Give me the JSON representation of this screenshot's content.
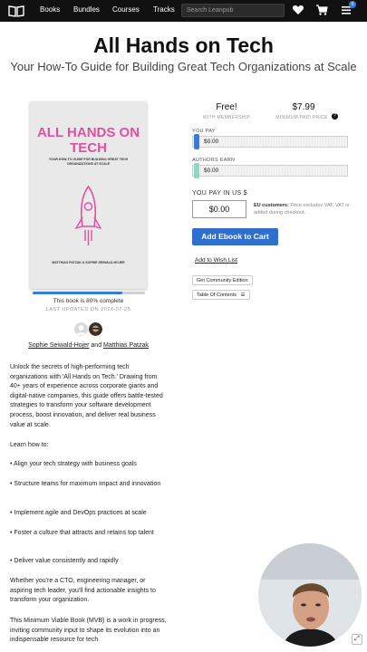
{
  "nav": {
    "links": [
      "Books",
      "Bundles",
      "Courses",
      "Tracks"
    ],
    "search_placeholder": "Search Leanpub",
    "menu_badge": "0",
    "icons": [
      "book-logo-icon",
      "heart-icon",
      "cart-icon",
      "menu-icon"
    ]
  },
  "book": {
    "title": "All Hands on Tech",
    "subtitle": "Your How-To Guide for Building Great Tech Organizations at Scale",
    "cover_title": "ALL HANDS ON TECH",
    "cover_subtitle": "YOUR HOW-TO GUIDE FOR BUILDING GREAT TECH ORGANIZATIONS AT SCALE",
    "cover_authors": "MATTHIAS PATZAK & SOPHIE SEIWALD-HOJER",
    "progress_percent": 80,
    "complete_text": "This book is 80% complete",
    "last_updated": "LAST UPDATED ON 2024-07-25",
    "author1": "Sophie Seiwald-Hojer",
    "and": "and",
    "author2": "Matthias Patzak"
  },
  "pricing": {
    "free_price": "Free!",
    "free_caption": "WITH MEMBERSHIP",
    "min_price": "$7.99",
    "min_caption": "MINIMUM PAID PRICE",
    "you_pay_label": "YOU PAY",
    "you_pay_value": "$0.00",
    "authors_earn_label": "AUTHORS EARN",
    "authors_earn_value": "$0.00",
    "pay_in_label": "YOU PAY IN US $",
    "pay_in_value": "$0.00",
    "eu_bold": "EU customers:",
    "eu_text": " Price excludes VAT. VAT is added during checkout.",
    "cart_button": "Add Ebook to Cart",
    "wishlist": "Add to Wish List",
    "community_button": "Get Community Edition",
    "toc_button": "Table Of Contents",
    "colors": {
      "accent": "#2f6fd0",
      "pink": "#e0509f"
    }
  },
  "description": {
    "p1": "Unlock the secrets of high-performing tech organizations with 'All Hands on Tech.' Drawing from 40+ years of experience across corporate giants and digital-native companies, this guide offers battle-tested strategies to transform your software development process, boost innovation, and deliver real business value at scale.",
    "p2": "Learn how to:",
    "b1": "• Align your tech strategy with business goals",
    "b2": "• Structure teams for maximum impact and innovation",
    "b3": "• Implement agile and DevOps practices at scale",
    "b4": "• Foster a culture that attracts and retains top talent",
    "b5": "• Deliver value consistently and rapidly",
    "p3": "Whether you're a CTO, engineering manager, or aspiring tech leader, you'll find actionable insights to transform your organization.",
    "p4": "This Minimum Viable Book (MVB) is a work in progress, inviting community input to shape its evolution into an indispensable resource for tech"
  }
}
